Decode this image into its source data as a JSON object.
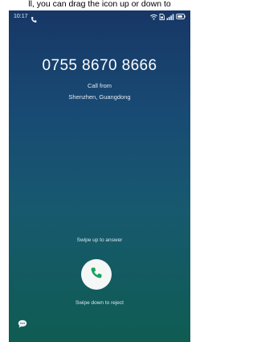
{
  "caption": "ll, you can drag the icon up or down to",
  "status_bar": {
    "time": "10:17",
    "icons": [
      "phone-call-icon",
      "wifi-icon",
      "sim-icon",
      "signal-icon",
      "battery-icon"
    ]
  },
  "call": {
    "number": "0755 8670 8666",
    "call_from": "Call from",
    "location": "Shenzhen, Guangdong"
  },
  "actions": {
    "swipe_up": "Swipe up to answer",
    "swipe_down": "Swipe down to reject",
    "answer_icon": "phone-icon",
    "message_icon": "message-bubble-icon"
  },
  "colors": {
    "background_top": "#173766",
    "background_bottom": "#0f5c52",
    "answer_button": "#f4f7f6",
    "answer_icon": "#1aa260"
  }
}
